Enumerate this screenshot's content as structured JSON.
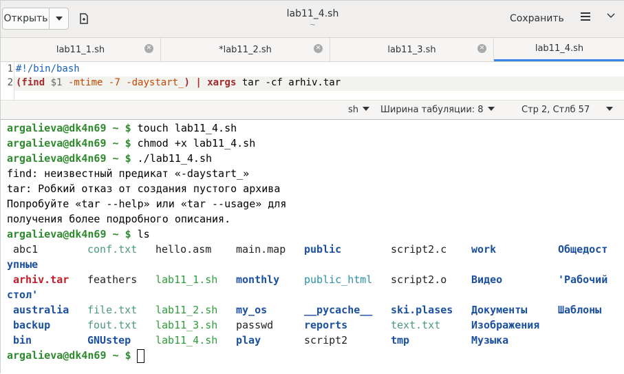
{
  "header": {
    "open_label": "Открыть",
    "title": "lab11_4.sh",
    "subtitle": "~",
    "save_label": "Сохранить"
  },
  "tabs": [
    {
      "label": "lab11_1.sh",
      "active": false
    },
    {
      "label": "*lab11_2.sh",
      "active": false
    },
    {
      "label": "lab11_3.sh",
      "active": false
    },
    {
      "label": "lab11_4.sh",
      "active": true
    }
  ],
  "editor": {
    "lines": [
      {
        "num": "1",
        "text": "#!/bin/bash"
      },
      {
        "num": "2",
        "text": "(find $1 -mtime -7 -daystart_) | xargs tar -cf arhiv.tar"
      }
    ]
  },
  "status": {
    "language": "sh",
    "tab_width": "Ширина табуляции: 8",
    "position": "Стр 2, Стлб 57"
  },
  "terminal": {
    "prompt": "argalieva@dk4n69 ~ $",
    "lines": [
      {
        "prompt": true,
        "cmd": "touch lab11_4.sh"
      },
      {
        "prompt": true,
        "cmd": "chmod +x lab11_4.sh"
      },
      {
        "prompt": true,
        "cmd": "./lab11_4.sh"
      },
      {
        "prompt": false,
        "cmd": "find: неизвестный предикат «-daystart_»"
      },
      {
        "prompt": false,
        "cmd": "tar: Робкий отказ от создания пустого архива"
      },
      {
        "prompt": false,
        "cmd": "Попробуйте «tar --help» или «tar --usage» для"
      },
      {
        "prompt": false,
        "cmd": "получения более подробного описания."
      },
      {
        "prompt": true,
        "cmd": "ls"
      }
    ],
    "ls_rows": [
      [
        "abc1",
        "conf.txt",
        "hello.asm",
        "main.map",
        "public",
        "script2.c",
        "work",
        "Общедост"
      ],
      [
        "упные"
      ],
      [
        "arhiv.tar",
        "feathers",
        "lab11_1.sh",
        "monthly",
        "public_html",
        "script2.o",
        "Видео",
        "'Рабочий"
      ],
      [
        "стол'"
      ],
      [
        "australia",
        "file.txt",
        "lab11_2.sh",
        "my_os",
        "__pycache__",
        "ski.plases",
        "Документы",
        "Шаблоны"
      ],
      [
        "backup",
        "fout.txt",
        "lab11_3.sh",
        "passwd",
        "reports",
        "text.txt",
        "Изображения"
      ],
      [
        "bin",
        "GNUstep",
        "lab11_4.sh",
        "play",
        "script2",
        "tmp",
        "Музыка"
      ]
    ]
  },
  "colors": {
    "prompt": "#2d8a2d",
    "directory": "#1a4fa0",
    "executable": "#2e9d3a",
    "archive": "#c01c28",
    "tab_accent": "#3584e4"
  }
}
